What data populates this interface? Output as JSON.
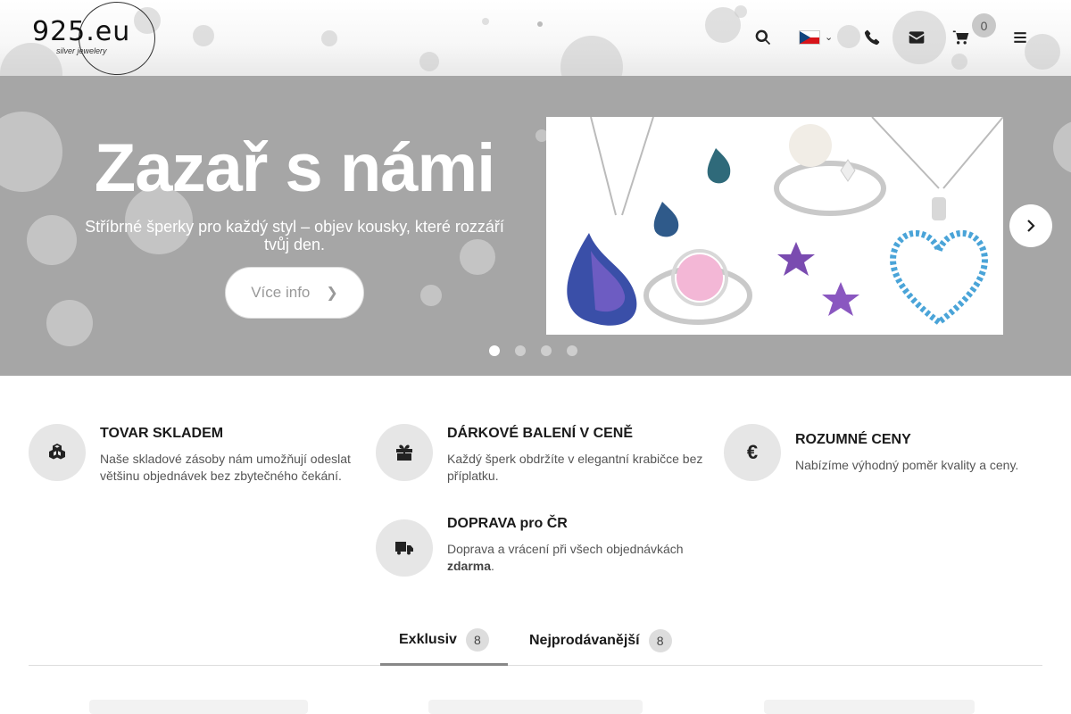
{
  "header": {
    "logo_text": "925.eu",
    "logo_subtitle": "silver jewelery",
    "icons": [
      "search-icon",
      "flag-cz-icon",
      "phone-icon",
      "envelope-icon",
      "cart-icon",
      "menu-icon"
    ],
    "cart_count": "0"
  },
  "hero": {
    "title": "Zazař s námi",
    "subtitle": "Stříbrné šperky pro každý styl – objev kousky, které rozzáří tvůj den.",
    "button_label": "Více info",
    "slide_count": 4,
    "active_slide": 1
  },
  "features": [
    {
      "icon": "cubes-icon",
      "title": "TOVAR SKLADEM",
      "desc": "Naše skladové zásoby nám umožňují odeslat většinu objednávek bez zbytečného čekání.",
      "desc_bold": "",
      "desc_tail": ""
    },
    {
      "icon": "gift-icon",
      "title": "DÁRKOVÉ BALENÍ V CENĚ",
      "desc": "Každý šperk obdržíte v elegantní krabičce bez příplatku.",
      "desc_bold": "",
      "desc_tail": ""
    },
    {
      "icon": "euro-icon",
      "title": "ROZUMNÉ CENY",
      "desc": "Nabízíme výhodný poměr kvality a ceny.",
      "desc_bold": "",
      "desc_tail": ""
    },
    {
      "icon": "truck-icon",
      "title": "DOPRAVA pro ČR",
      "desc": "Doprava a vrácení při všech objednávkách ",
      "desc_bold": "zdarma",
      "desc_tail": "."
    }
  ],
  "tabs": [
    {
      "label": "Exklusiv",
      "count": "8",
      "active": true
    },
    {
      "label": "Nejprodávanější",
      "count": "8",
      "active": false
    }
  ],
  "colors": {
    "hero_bg": "#a6a6a6",
    "feature_circle": "#e6e6e6",
    "badge_bg": "#c8c8c8"
  }
}
